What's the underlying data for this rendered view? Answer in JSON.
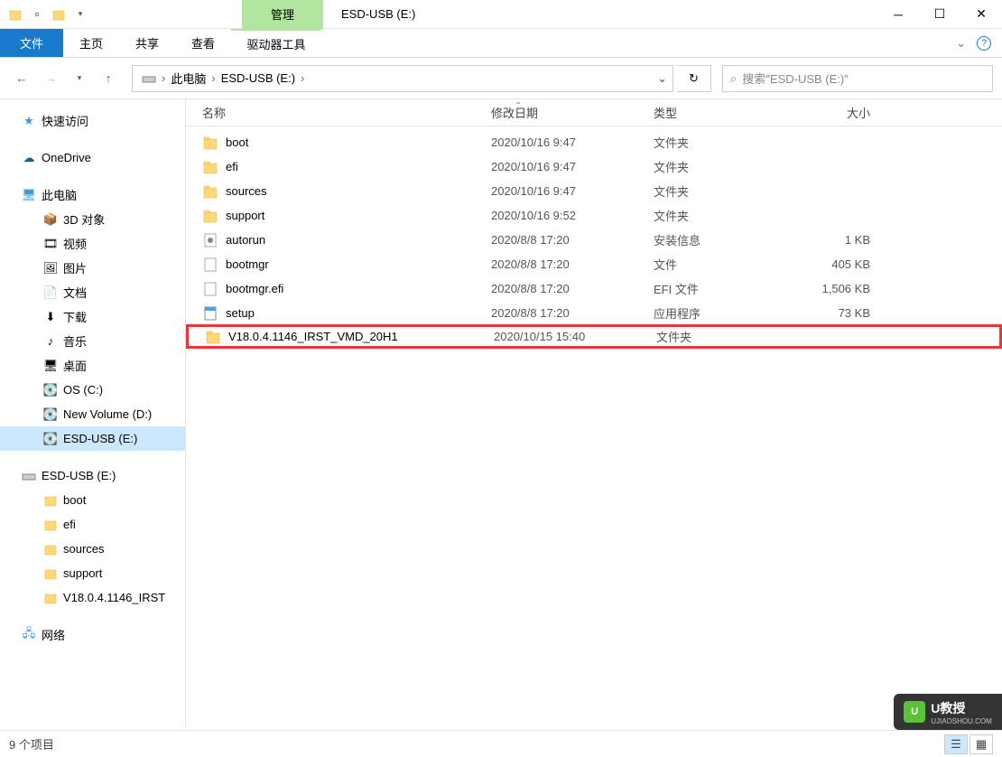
{
  "title": "ESD-USB (E:)",
  "context_tab": "管理",
  "tabs": {
    "file": "文件",
    "home": "主页",
    "share": "共享",
    "view": "查看",
    "tool": "驱动器工具"
  },
  "breadcrumb": {
    "pc": "此电脑",
    "drive": "ESD-USB (E:)"
  },
  "search": {
    "placeholder": "搜索\"ESD-USB (E:)\""
  },
  "columns": {
    "name": "名称",
    "date": "修改日期",
    "type": "类型",
    "size": "大小"
  },
  "sidebar": {
    "quick": "快速访问",
    "onedrive": "OneDrive",
    "thispc": "此电脑",
    "pc_children": [
      "3D 对象",
      "视频",
      "图片",
      "文档",
      "下载",
      "音乐",
      "桌面",
      "OS (C:)",
      "New Volume (D:)",
      "ESD-USB (E:)"
    ],
    "drive2": "ESD-USB (E:)",
    "drive_children": [
      "boot",
      "efi",
      "sources",
      "support",
      "V18.0.4.1146_IRST"
    ],
    "network": "网络"
  },
  "files": [
    {
      "name": "boot",
      "date": "2020/10/16 9:47",
      "type": "文件夹",
      "size": "",
      "icon": "folder"
    },
    {
      "name": "efi",
      "date": "2020/10/16 9:47",
      "type": "文件夹",
      "size": "",
      "icon": "folder"
    },
    {
      "name": "sources",
      "date": "2020/10/16 9:47",
      "type": "文件夹",
      "size": "",
      "icon": "folder"
    },
    {
      "name": "support",
      "date": "2020/10/16 9:52",
      "type": "文件夹",
      "size": "",
      "icon": "folder"
    },
    {
      "name": "autorun",
      "date": "2020/8/8 17:20",
      "type": "安装信息",
      "size": "1 KB",
      "icon": "inf"
    },
    {
      "name": "bootmgr",
      "date": "2020/8/8 17:20",
      "type": "文件",
      "size": "405 KB",
      "icon": "file"
    },
    {
      "name": "bootmgr.efi",
      "date": "2020/8/8 17:20",
      "type": "EFI 文件",
      "size": "1,506 KB",
      "icon": "file"
    },
    {
      "name": "setup",
      "date": "2020/8/8 17:20",
      "type": "应用程序",
      "size": "73 KB",
      "icon": "exe"
    },
    {
      "name": "V18.0.4.1146_IRST_VMD_20H1",
      "date": "2020/10/15 15:40",
      "type": "文件夹",
      "size": "",
      "icon": "folder",
      "hl": true
    }
  ],
  "status": "9 个项目",
  "watermark": {
    "brand": "U教授",
    "sub": "UJIAOSHOU.COM"
  }
}
